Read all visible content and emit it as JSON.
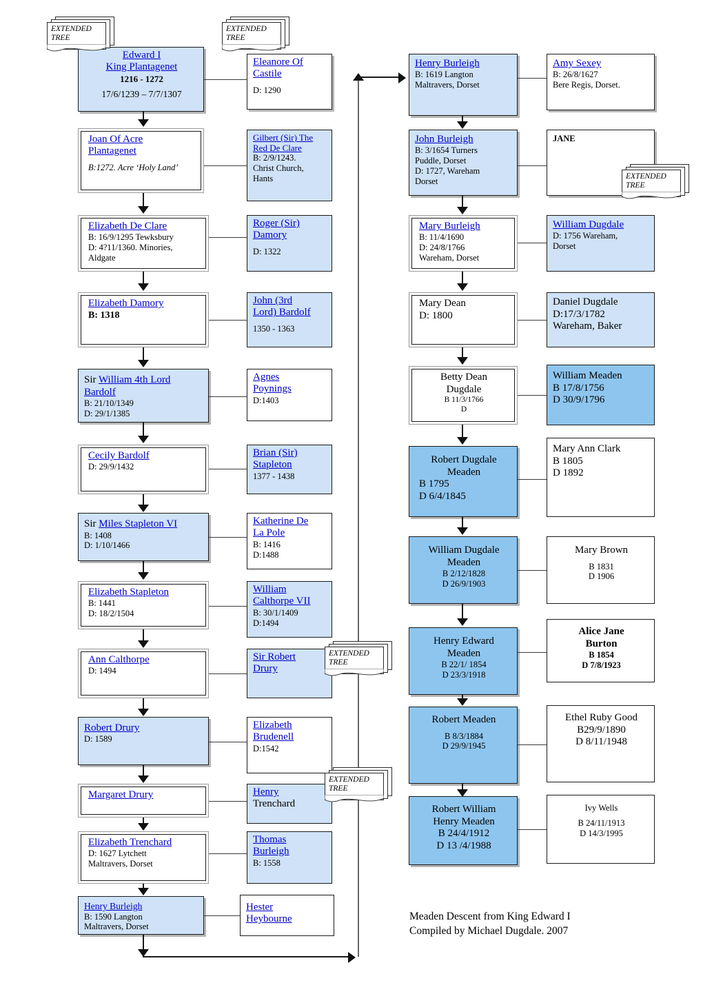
{
  "title": "Meaden Descent from King Edward I",
  "caption": {
    "line1": "Meaden Descent from King Edward I",
    "line2": "Compiled by Michael Dugdale. 2007"
  },
  "notes": {
    "extended_tree_label_line1": "EXTENDED",
    "extended_tree_label_line2": "TREE"
  },
  "colors": {
    "light_blue": "#cfe2f7",
    "mid_blue": "#8ec5ee",
    "white": "#ffffff",
    "link_blue": "#0000c8",
    "line": "#1a1a1a"
  },
  "left_column": [
    {
      "name": "Edward I",
      "name2": "King  Plantagenet",
      "l1": "1216 - 1272",
      "l2": "17/6/1239 – 7/7/1307"
    },
    {
      "name": "Joan Of Acre",
      "name2": "Plantagenet",
      "l1": "B:1272. Acre ‘Holy Land’"
    },
    {
      "name": "Elizabeth De Clare",
      "l1": "B: 16/9/1295 Tewksbury",
      "l2": "D: 4?11/1360. Minories,",
      "l3": "Aldgate"
    },
    {
      "name": "Elizabeth Damory",
      "l1": "B: 1318"
    },
    {
      "prefix": "Sir ",
      "name": "William 4th Lord",
      "name2": "Bardolf",
      "l1": "B: 21/10/1349",
      "l2": "D: 29/1/1385"
    },
    {
      "name": "Cecily Bardolf",
      "l1": "D: 29/9/1432"
    },
    {
      "prefix": "Sir ",
      "name": "Miles Stapleton VI",
      "l1": "B: 1408",
      "l2": "D: 1/10/1466"
    },
    {
      "name": "Elizabeth Stapleton",
      "l1": "B: 1441",
      "l2": "D: 18/2/1504"
    },
    {
      "name": "Ann Calthorpe",
      "l1": "D: 1494"
    },
    {
      "name": "Robert Drury",
      "l1": "D: 1589"
    },
    {
      "name": "Margaret Drury"
    },
    {
      "name": "Elizabeth Trenchard",
      "l1": "D: 1627 Lytchett",
      "l2": "Maltravers, Dorset"
    },
    {
      "name": "Henry Burleigh",
      "l1": "B: 1590 Langton",
      "l2": "Maltravers, Dorset"
    }
  ],
  "left_spouses": [
    {
      "name": "Eleanore Of",
      "name2": "Castile",
      "l1": "D: 1290"
    },
    {
      "name": "Gilbert (Sir) The",
      "name2": "Red De Clare",
      "l1": "B: 2/9/1243.",
      "l2": "Christ Church,",
      "l3": "Hants"
    },
    {
      "name": "Roger (Sir)",
      "name2": "Damory",
      "l1": "D: 1322"
    },
    {
      "name": "John (3rd",
      "name2": "Lord) Bardolf",
      "l1": "1350 - 1363"
    },
    {
      "name": "Agnes",
      "name2": "Poynings",
      "l1": "D:1403"
    },
    {
      "name": "Brian (Sir)",
      "name2": "Stapleton",
      "l1": "1377 - 1438"
    },
    {
      "name": "Katherine De",
      "name2": "La Pole",
      "l1": "B: 1416",
      "l2": "D:1488"
    },
    {
      "name": "William",
      "name2": "Calthorpe VII",
      "l1": "B: 30/1/1409",
      "l2": "D:1494"
    },
    {
      "prefix": "Sir ",
      "name": "Robert",
      "name2": "Drury"
    },
    {
      "name": "Elizabeth",
      "name2": "Brudenell",
      "l1": "D:1542"
    },
    {
      "name": "Henry",
      "name2": "Trenchard"
    },
    {
      "name": "Thomas",
      "name2": "Burleigh",
      "l1": "B: 1558"
    },
    {
      "name": "Hester",
      "name2": "Heybourne"
    }
  ],
  "right_column": [
    {
      "name": "Henry Burleigh",
      "l1": "B: 1619 Langton",
      "l2": "Maltravers, Dorset"
    },
    {
      "name": "John Burleigh",
      "l1": "B: 3/1654 Turners",
      "l2": "Puddle, Dorset",
      "l3": "D: 1727, Wareham",
      "l4": "Dorset"
    },
    {
      "name": "Mary Burleigh",
      "l1": "B: 11/4/1690",
      "l2": "D: 24/8/1766",
      "l3": "Wareham, Dorset"
    },
    {
      "name": "Mary Dean",
      "l1": "D: 1800"
    },
    {
      "name": "Betty Dean",
      "name2": "Dugdale",
      "l1": "B 11/3/1766",
      "l2": "D"
    },
    {
      "name": "Robert Dugdale",
      "name2": "Meaden",
      "l1": "B 1795",
      "l2": "D 6/4/1845"
    },
    {
      "name": "William Dugdale",
      "name2": "Meaden",
      "l1": "B 2/12/1828",
      "l2": "D 26/9/1903"
    },
    {
      "name": "Henry Edward",
      "name2": "Meaden",
      "l1": "B 22/1/ 1854",
      "l2": "D 23/3/1918"
    },
    {
      "name": "Robert Meaden",
      "l1": "B 8/3/1884",
      "l2": "D 29/9/1945"
    },
    {
      "name": "Robert William",
      "name2": "Henry Meaden",
      "l1": "B 24/4/1912",
      "l2": "D 13 /4/1988"
    }
  ],
  "right_spouses": [
    {
      "name": "Amy Sexey",
      "l1": "B: 26/8/1627",
      "l2": "Bere Regis, Dorset."
    },
    {
      "name": "JANE"
    },
    {
      "name": "William Dugdale",
      "l1": "D: 1756 Wareham,",
      "l2": "Dorset"
    },
    {
      "name": "Daniel Dugdale",
      "l1": "D:17/3/1782",
      "l2": "Wareham, Baker"
    },
    {
      "name": "William Meaden",
      "l1": "B 17/8/1756",
      "l2": "D 30/9/1796"
    },
    {
      "name": "Mary Ann Clark",
      "l1": "B 1805",
      "l2": "D 1892"
    },
    {
      "name": "Mary Brown",
      "l1": "B 1831",
      "l2": "D 1906"
    },
    {
      "name": "Alice Jane",
      "name2": "Burton",
      "l1": "B 1854",
      "l2": "D 7/8/1923"
    },
    {
      "name": "Ethel Ruby Good",
      "l1": "B29/9/1890",
      "l2": "D 8/11/1948"
    },
    {
      "name": "Ivy Wells",
      "l1": "B 24/11/1913",
      "l2": "D 14/3/1995"
    }
  ]
}
